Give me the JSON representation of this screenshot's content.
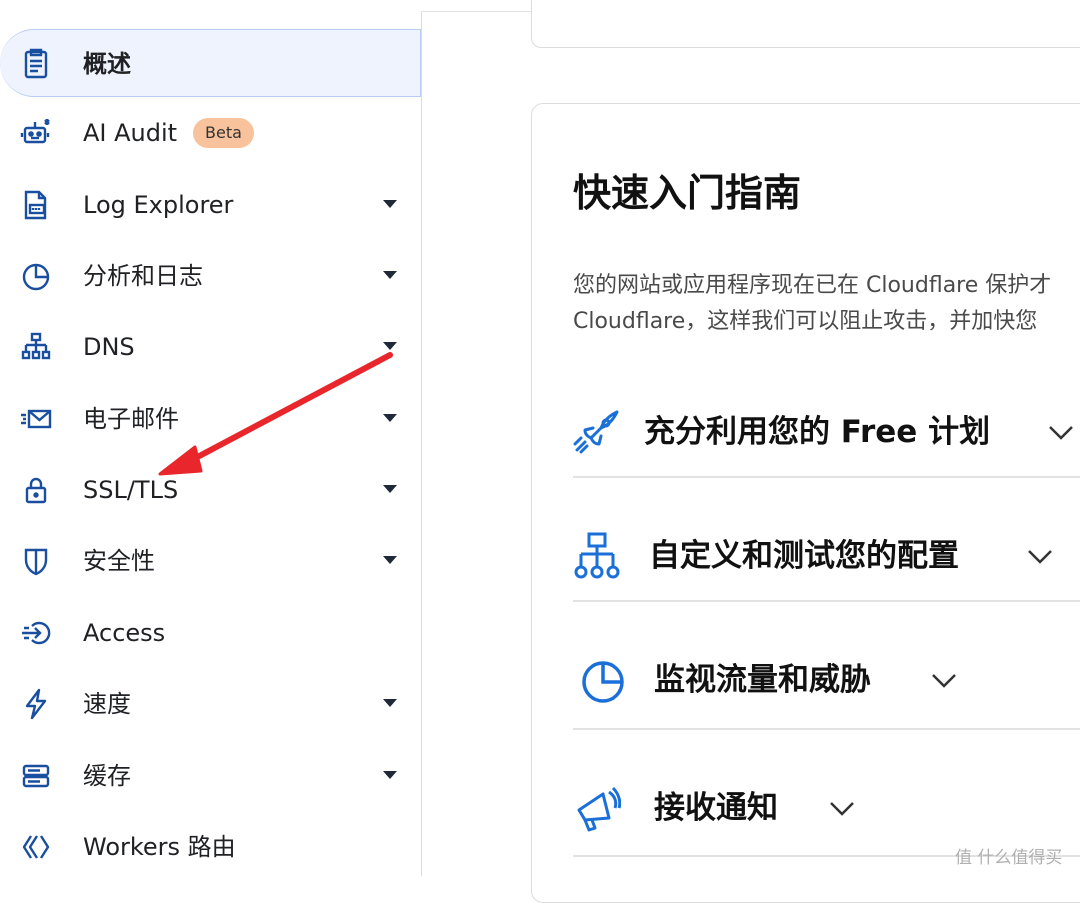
{
  "sidebar": {
    "items": [
      {
        "label": "概述",
        "icon": "clipboard-icon",
        "active": true
      },
      {
        "label": "AI Audit",
        "icon": "robot-icon",
        "badge": "Beta"
      },
      {
        "label": "Log Explorer",
        "icon": "log-file-icon",
        "expandable": true
      },
      {
        "label": "分析和日志",
        "icon": "pie-chart-icon",
        "expandable": true
      },
      {
        "label": "DNS",
        "icon": "network-tree-icon",
        "expandable": true
      },
      {
        "label": "电子邮件",
        "icon": "envelope-icon",
        "expandable": true
      },
      {
        "label": "SSL/TLS",
        "icon": "lock-icon",
        "expandable": true
      },
      {
        "label": "安全性",
        "icon": "shield-icon",
        "expandable": true
      },
      {
        "label": "Access",
        "icon": "access-arrow-icon"
      },
      {
        "label": "速度",
        "icon": "lightning-icon",
        "expandable": true
      },
      {
        "label": "缓存",
        "icon": "server-icon",
        "expandable": true
      },
      {
        "label": "Workers 路由",
        "icon": "workers-icon"
      }
    ]
  },
  "guide": {
    "title": "快速入门指南",
    "desc_line1": "您的网站或应用程序现在已在 Cloudflare 保护才",
    "desc_line2": "Cloudflare，这样我们可以阻止攻击，并加快您",
    "sections": [
      {
        "title": "充分利用您的 Free 计划",
        "icon": "rocket-icon"
      },
      {
        "title": "自定义和测试您的配置",
        "icon": "network-tree-icon"
      },
      {
        "title": "监视流量和威胁",
        "icon": "pie-chart-icon"
      },
      {
        "title": "接收通知",
        "icon": "megaphone-icon"
      }
    ]
  },
  "watermark": "值 什么值得买",
  "colors": {
    "accent_blue": "#1a6fd8",
    "active_bg": "#eef3fd",
    "beta_badge": "#f8c39c",
    "annotation_arrow": "#e8262b"
  }
}
